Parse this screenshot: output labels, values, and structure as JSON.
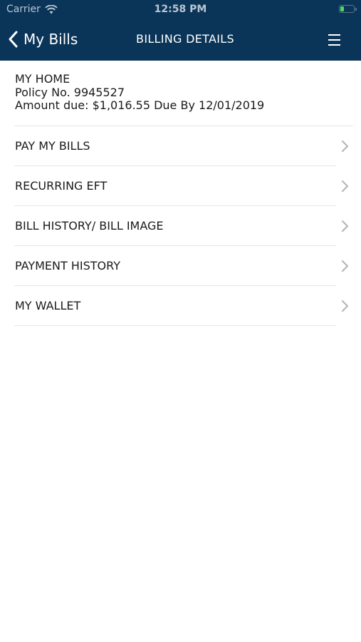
{
  "status_bar": {
    "carrier": "Carrier",
    "time": "12:58 PM"
  },
  "nav": {
    "back_label": "My Bills",
    "title": "BILLING DETAILS"
  },
  "policy": {
    "name": "MY HOME",
    "number": "Policy No. 9945527",
    "amount_due": "Amount due: $1,016.55 Due By 12/01/2019"
  },
  "menu": {
    "items": [
      {
        "label": "PAY MY BILLS"
      },
      {
        "label": "RECURRING EFT"
      },
      {
        "label": "BILL HISTORY/ BILL IMAGE"
      },
      {
        "label": "PAYMENT HISTORY"
      },
      {
        "label": "MY WALLET"
      }
    ]
  },
  "colors": {
    "nav_background": "#0b3558",
    "nav_text": "#ffffff",
    "chevron": "#b3b3b3",
    "separator": "#e6e6e6",
    "battery_fill": "#4cd964"
  },
  "icons": {
    "back": "chevron-left-icon",
    "menu": "hamburger-menu-icon",
    "row": "chevron-right-icon",
    "wifi": "wifi-icon",
    "battery": "battery-icon"
  }
}
